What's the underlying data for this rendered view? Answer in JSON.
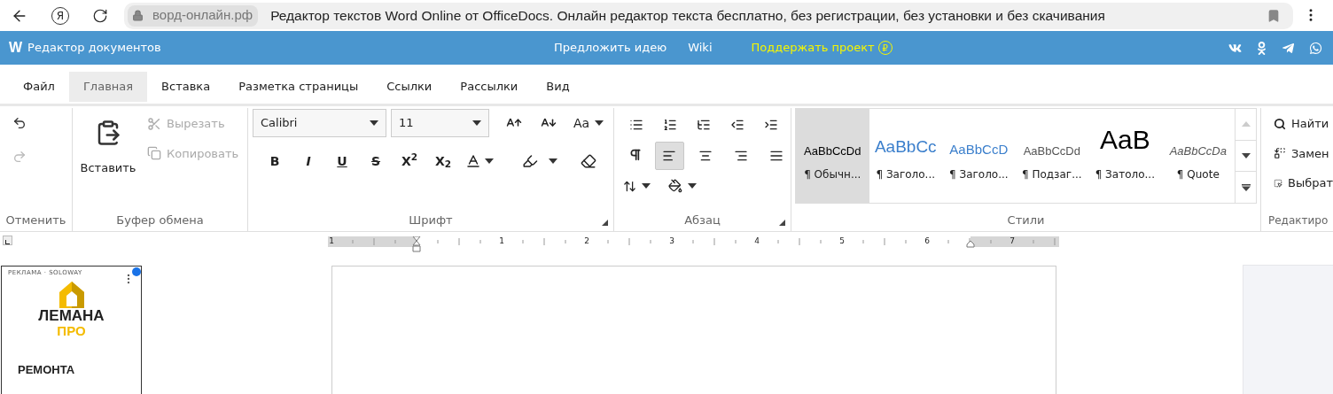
{
  "browser": {
    "yandex_letter": "Я",
    "domain": "ворд-онлайн.рф",
    "page_title": "Редактор текстов Word Online от OfficeDocs. Онлайн редактор текста бесплатно, без регистрации, без установки и без скачивания"
  },
  "header": {
    "logo": "W",
    "title": "Редактор документов",
    "links": [
      "Предложить идею",
      "Wiki"
    ],
    "support": {
      "label": "Поддержать проект",
      "symbol": "₽"
    }
  },
  "tabs": [
    {
      "label": "Файл",
      "selected": false
    },
    {
      "label": "Главная",
      "selected": true
    },
    {
      "label": "Вставка",
      "selected": false
    },
    {
      "label": "Разметка страницы",
      "selected": false
    },
    {
      "label": "Ссылки",
      "selected": false
    },
    {
      "label": "Рассылки",
      "selected": false
    },
    {
      "label": "Вид",
      "selected": false
    }
  ],
  "undo_group": {
    "label": "Отменить",
    "undo_disabled": false,
    "redo_disabled": true
  },
  "clipboard": {
    "label": "Буфер обмена",
    "paste": "Вставить",
    "cut": {
      "label": "Вырезать",
      "disabled": true
    },
    "copy": {
      "label": "Копировать",
      "disabled": true
    }
  },
  "font": {
    "label": "Шрифт",
    "font_name": "Calibri",
    "font_size": "11",
    "change_case": "Aa",
    "format_buttons": [
      {
        "kind": "bold",
        "label": "B"
      },
      {
        "kind": "italic",
        "label": "I"
      },
      {
        "kind": "underline",
        "label": "U"
      },
      {
        "kind": "strike",
        "label": "S"
      },
      {
        "kind": "script",
        "label": "X$^{2}$"
      },
      {
        "kind": "script",
        "label": "X$_{2}$"
      }
    ]
  },
  "paragraph": {
    "label": "Абзац",
    "alignment": [
      {
        "kind": "left",
        "selected": true
      },
      {
        "kind": "center",
        "selected": false
      },
      {
        "kind": "right",
        "selected": false
      },
      {
        "kind": "justify",
        "selected": false
      }
    ]
  },
  "styles": {
    "label": "Стили",
    "items": [
      {
        "kind": "normal",
        "sample": "AaBbCcDd",
        "name": "¶ Обычн...",
        "selected": true
      },
      {
        "kind": "heading1",
        "sample": "AaBbCc",
        "name": "¶ Заголо...",
        "selected": false
      },
      {
        "kind": "heading2",
        "sample": "AaBbCcD",
        "name": "¶ Заголо...",
        "selected": false
      },
      {
        "kind": "subtitle",
        "sample": "AaBbCcDd",
        "name": "¶ Подзаг...",
        "selected": false
      },
      {
        "kind": "title",
        "sample": "AaB",
        "name": "¶ Затоло...",
        "selected": false
      },
      {
        "kind": "quote",
        "sample": "AaBbCcDa",
        "name": "¶ Quote",
        "selected": false
      }
    ]
  },
  "editing": {
    "label": "Редактиро",
    "find": "Найти",
    "replace": "Замен",
    "select": "Выбрат"
  },
  "ruler": {
    "numbers": [
      "1",
      "1",
      "2",
      "3",
      "4",
      "5",
      "6",
      "7"
    ]
  },
  "ad": {
    "label": "РЕКЛАМА · SOLOWAY",
    "brand_top": "ЛЕМАНА",
    "brand_bottom": "ПРО",
    "headline": "РЕМОНТА"
  }
}
